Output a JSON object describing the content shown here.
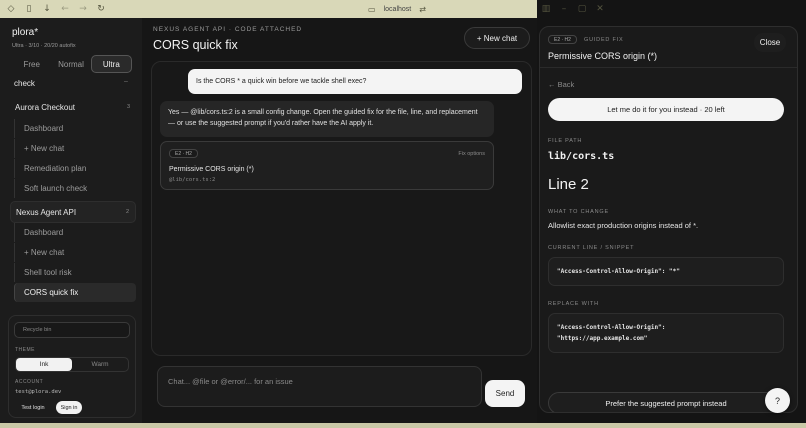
{
  "browser": {
    "url": "localhost"
  },
  "sidebar": {
    "brand": "plora*",
    "usage": "Ultra · 3/10 · 20/20 autofix",
    "plans": [
      "Free",
      "Normal",
      "Ultra"
    ],
    "active_plan": "Ultra",
    "partial_section": "check",
    "sections": [
      {
        "title": "Aurora Checkout",
        "count": "3",
        "items": [
          "Dashboard",
          "+ New chat",
          "Remediation plan",
          "Soft launch check"
        ]
      },
      {
        "title": "Nexus Agent API",
        "count": "2",
        "items": [
          "Dashboard",
          "+ New chat",
          "Shell tool risk",
          "CORS quick fix"
        ]
      }
    ],
    "active_item": "CORS quick fix",
    "recycle_bin": "Recycle bin",
    "theme_label": "THEME",
    "themes": [
      "Ink",
      "Warm"
    ],
    "active_theme": "Ink",
    "account_label": "ACCOUNT",
    "email": "test@plora.dev",
    "test_login": "Test login",
    "sign_in": "Sign in"
  },
  "main": {
    "eyebrow": "NEXUS AGENT API · CODE ATTACHED",
    "title": "CORS quick fix",
    "new_chat": "+ New chat",
    "user_message": "Is the CORS * a quick win before we tackle shell exec?",
    "assistant_message": "Yes — @lib/cors.ts:2 is a small config change. Open the guided fix for the file, line, and replacement — or use the suggested prompt if you'd rather have the AI apply it.",
    "fix_card": {
      "badge": "E2 · H2",
      "options": "Fix options",
      "title": "Permissive CORS origin (*)",
      "location": "@lib/cors.ts:2"
    },
    "composer_placeholder": "Chat... @file or @error/... for an issue",
    "send": "Send"
  },
  "guided_fix": {
    "badge": "E2 · H2",
    "label": "GUIDED FIX",
    "close": "Close",
    "title": "Permissive CORS origin (*)",
    "back": "← Back",
    "do_it": "Let me do it for you instead · 20 left",
    "file_path_label": "FILE PATH",
    "file_path": "lib/cors.ts",
    "line": "Line 2",
    "what_label": "WHAT TO CHANGE",
    "what": "Allowlist exact production origins instead of *.",
    "current_label": "CURRENT LINE / SNIPPET",
    "current": "\"Access-Control-Allow-Origin\": \"*\"",
    "replace_label": "REPLACE WITH",
    "replace_1": "\"Access-Control-Allow-Origin\":",
    "replace_2": "\"https://app.example.com\"",
    "prefer": "Prefer the suggested prompt instead",
    "help": "?"
  }
}
